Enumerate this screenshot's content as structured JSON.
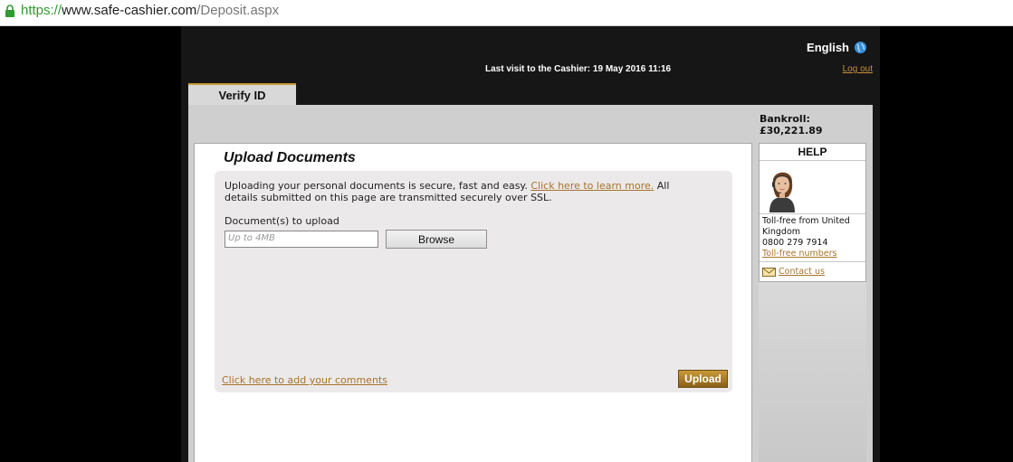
{
  "browser": {
    "url_scheme": "https://",
    "url_host": "www.safe-cashier.com",
    "url_path": "/Deposit.aspx"
  },
  "header": {
    "language": "English",
    "last_visit": "Last visit to the Cashier: 19 May 2016 11:16",
    "logout": "Log out"
  },
  "tabs": [
    {
      "label": "Verify ID"
    }
  ],
  "upload": {
    "title": "Upload Documents",
    "intro_text": "Uploading your personal documents is secure, fast and easy.",
    "learn_more_link": "Click here to learn more.",
    "intro_tail": "All details submitted on this page are transmitted securely over SSL.",
    "documents_label": "Document(s) to upload",
    "file_placeholder": "Up to 4MB",
    "browse_label": "Browse",
    "comments_link": "Click here to add your comments",
    "upload_label": "Upload"
  },
  "sidebar": {
    "bankroll_label": "Bankroll:",
    "bankroll_value": "£30,221.89",
    "help_title": "HELP",
    "tollfree_label": "Toll-free from United Kingdom",
    "phone": "0800 279 7914",
    "tollfree_link": "Toll-free numbers",
    "contact_link": "Contact us"
  },
  "colors": {
    "accent_gold": "#c99a3a",
    "link_brown": "#a8732a",
    "secure_green": "#2e9b2e"
  }
}
